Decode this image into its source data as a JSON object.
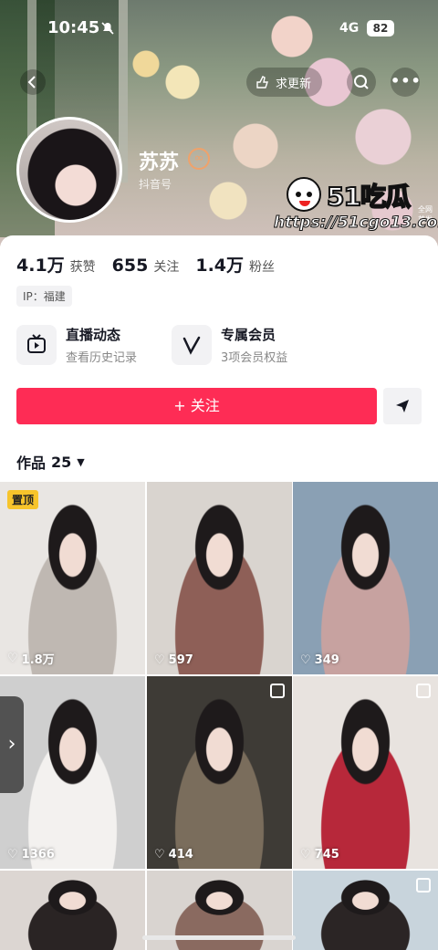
{
  "status_bar": {
    "time": "10:45",
    "network": "4G",
    "battery": "82"
  },
  "nav": {
    "update_label": "求更新",
    "more_label": "•••"
  },
  "profile": {
    "name": "苏苏",
    "douyin_id_label": "抖音号",
    "stats": [
      {
        "value": "4.1万",
        "label": "获赞"
      },
      {
        "value": "655",
        "label": "关注"
      },
      {
        "value": "1.4万",
        "label": "粉丝"
      }
    ],
    "ip": "IP：福建"
  },
  "watermark": {
    "logo": "51吃瓜",
    "small": "全网首发",
    "url": "https://51cgo13.com"
  },
  "features": {
    "live": {
      "title": "直播动态",
      "subtitle": "查看历史记录"
    },
    "member": {
      "title": "专属会员",
      "subtitle": "3项会员权益"
    }
  },
  "actions": {
    "follow_label": "+ 关注"
  },
  "works": {
    "label": "作品",
    "count": "25"
  },
  "grid": [
    {
      "likes": "1.8万",
      "pin": "置顶",
      "colors": [
        "#e9e6e3",
        "#bfb8b2"
      ]
    },
    {
      "likes": "597",
      "colors": [
        "#d9d4cf",
        "#8e5f57"
      ]
    },
    {
      "likes": "349",
      "colors": [
        "#8aa0b4",
        "#c7a2a0"
      ]
    },
    {
      "likes": "1366",
      "colors": [
        "#cfcfcf",
        "#f3f1ef"
      ]
    },
    {
      "likes": "414",
      "colors": [
        "#3e3b36",
        "#7a6d5c"
      ]
    },
    {
      "likes": "745",
      "colors": [
        "#e8e3df",
        "#b7283a"
      ]
    },
    {
      "colors": [
        "#dcd6d2",
        "#2a2424"
      ]
    },
    {
      "colors": [
        "#d9d4d0",
        "#8a6a60"
      ]
    },
    {
      "colors": [
        "#c8d4dc",
        "#2b2525"
      ]
    }
  ],
  "side_handle": "›"
}
